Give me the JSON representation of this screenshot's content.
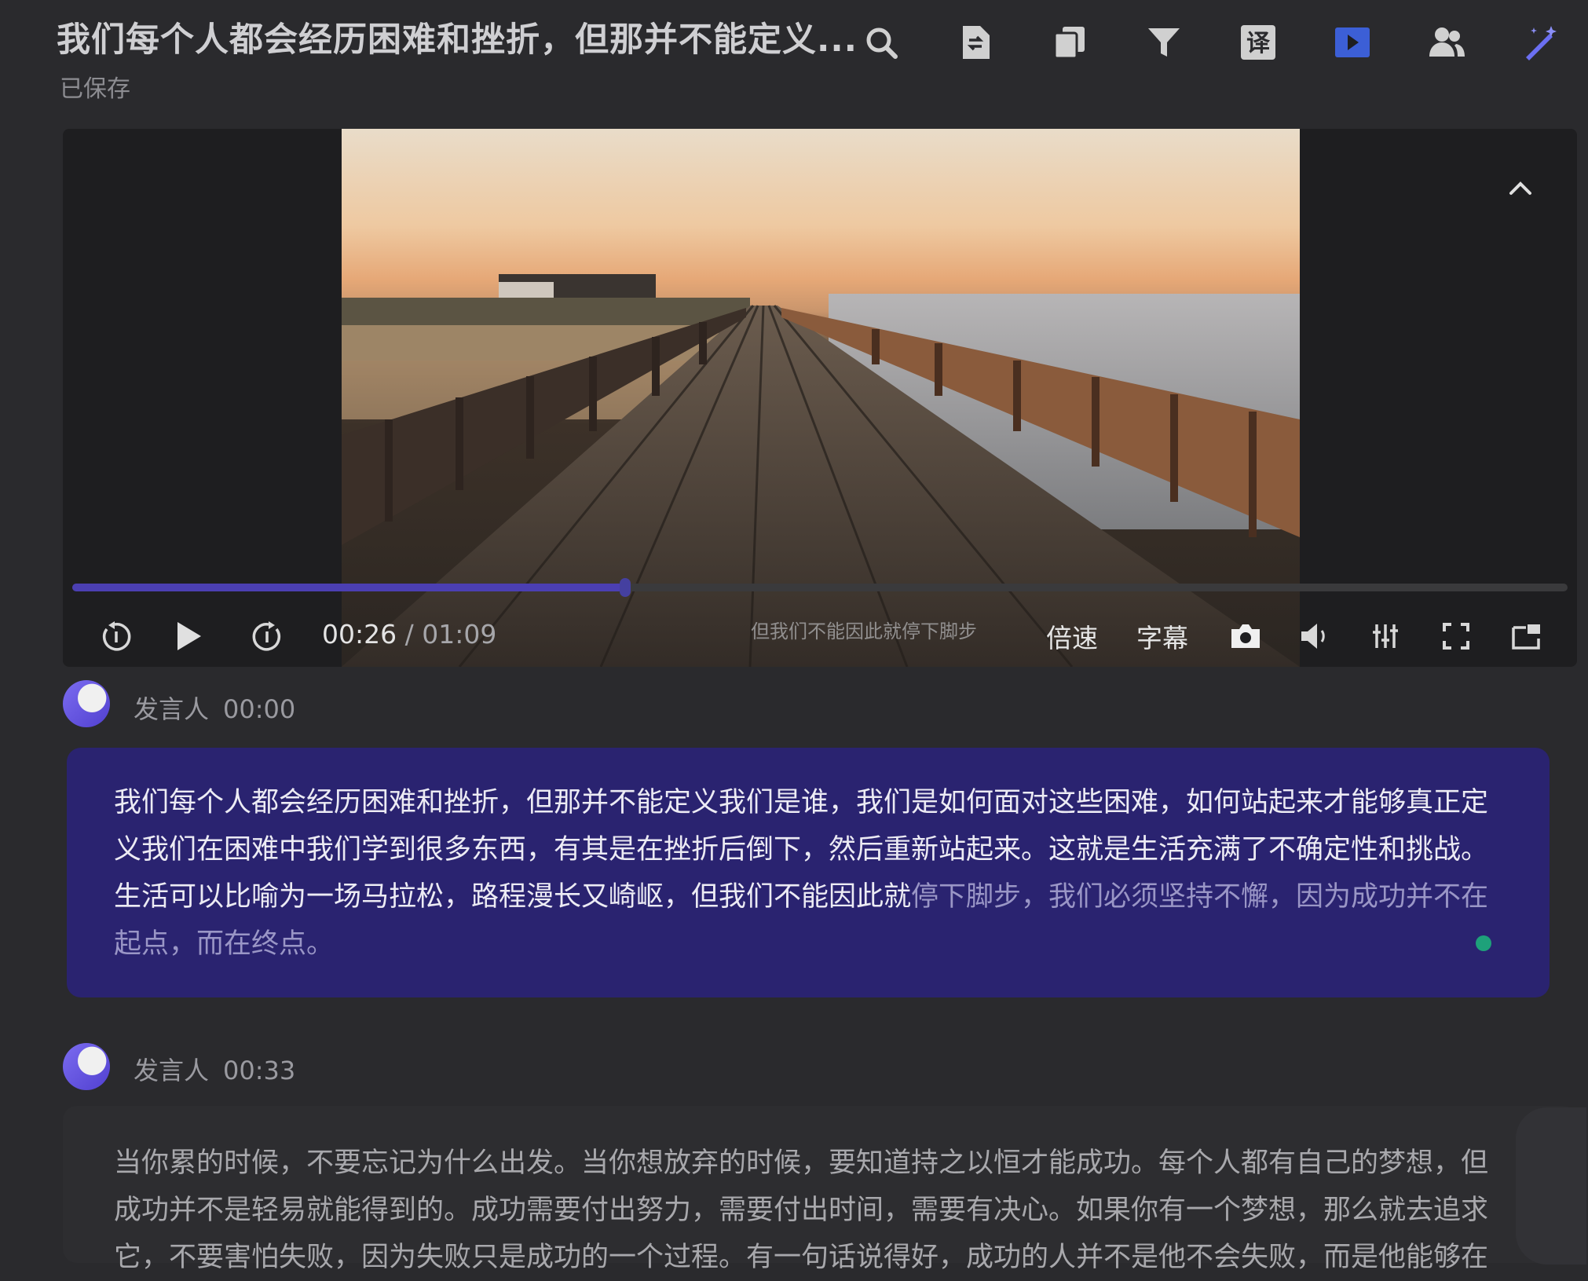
{
  "header": {
    "title": "我们每个人都会经历困难和挫折，但那并不能定义...",
    "saved_status": "已保存"
  },
  "toolbar": {
    "icons": [
      "search-icon",
      "document-export-icon",
      "copy-icon",
      "filter-icon",
      "translate-icon",
      "video-icon",
      "speakers-icon",
      "magic-wand-icon"
    ],
    "translate_glyph": "译",
    "active_color": "#3c5fd6",
    "magic_color": "#6b6ff2"
  },
  "player": {
    "current_time": "00:26",
    "separator": " / ",
    "total_time": "01:09",
    "progress": 0.37,
    "subtitle_overlay": "但我们不能因此就停下脚步",
    "speed_label": "倍速",
    "subtitle_label": "字幕",
    "accent_color": "#4b3fb2"
  },
  "transcript": [
    {
      "speaker": "发言人",
      "timestamp": "00:00",
      "text_spoken": "我们每个人都会经历困难和挫折，但那并不能定义我们是谁，我们是如何面对这些困难，如何站起来才能够真正定义我们在困难中我们学到很多东西，有其是在挫折后倒下，然后重新站起来。这就是生活充满了不确定性和挑战。生活可以比喻为一场马拉松，路程漫长又崎岖，但我们不能因此就",
      "text_pending": "停下脚步，我们必须坚持不懈，因为成功并不在起点，而在终点。",
      "active": true
    },
    {
      "speaker": "发言人",
      "timestamp": "00:33",
      "text": "当你累的时候，不要忘记为什么出发。当你想放弃的时候，要知道持之以恒才能成功。每个人都有自己的梦想，但成功并不是轻易就能得到的。成功需要付出努力，需要付出时间，需要有决心。如果你有一个梦想，那么就去追求它，不要害怕失败，因为失败只是成功的一个过程。有一句话说得好，成功的人并不是他不会失败，而是他能够在"
    }
  ]
}
